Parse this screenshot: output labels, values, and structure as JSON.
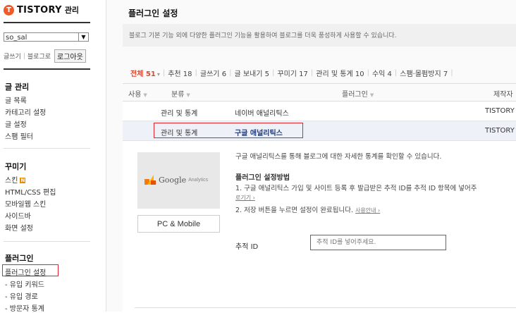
{
  "brand": {
    "mark": "T",
    "name": "TISTORY",
    "sub": "관리"
  },
  "sidebar": {
    "blog_select": "so_sal",
    "quick_links": {
      "write": "글쓰기",
      "blog": "블로그로",
      "logout": "로그아웃"
    },
    "sections": [
      {
        "title": "글 관리",
        "items": [
          "글 목록",
          "카테고리 설정",
          "글 설정",
          "스팸 필터"
        ]
      },
      {
        "title": "꾸미기",
        "items": [
          "스킨",
          "HTML/CSS 편집",
          "모바일웹 스킨",
          "사이드바",
          "화면 설정"
        ],
        "badge": "N"
      },
      {
        "title": "플러그인",
        "items": [
          "플러그인 설정",
          "- 유입 키워드",
          "- 유입 경로",
          "- 방문자 통계"
        ]
      }
    ]
  },
  "main": {
    "title": "플러그인 설정",
    "description": "블로그 기본 기능 외에 다양한 플러그인 기능을 활용하여 블로그를 더욱 풍성하게 사용할 수 있습니다.",
    "filters": [
      {
        "label": "전체",
        "count": "51"
      },
      {
        "label": "추천",
        "count": "18"
      },
      {
        "label": "글쓰기",
        "count": "6"
      },
      {
        "label": "글 보내기",
        "count": "5"
      },
      {
        "label": "꾸미기",
        "count": "17"
      },
      {
        "label": "관리 및 통계",
        "count": "10"
      },
      {
        "label": "수익",
        "count": "4"
      },
      {
        "label": "스팸·몰펌방지",
        "count": "7"
      }
    ],
    "table": {
      "headers": {
        "use": "사용",
        "category": "분류",
        "plugin": "플러그인",
        "author": "제작자"
      },
      "rows": [
        {
          "category": "관리 및 통계",
          "name": "네이버 애널리틱스",
          "author": "TISTORY"
        },
        {
          "category": "관리 및 통계",
          "name": "구글 애널리틱스",
          "author": "TISTORY"
        }
      ]
    },
    "detail": {
      "thumb_logo": "Google",
      "thumb_logo_sub": "Analytics",
      "platform": "PC & Mobile",
      "summary": "구글 애널리틱스를 통해 블로그에 대한 자세한 통계를 확인할 수 있습니다.",
      "howto_title": "플러그인 설정방법",
      "step1": "1. 구글 애널리틱스 가입 및 사이트 등록 후 발급받은 추적 ID를 추적 ID 항목에 넣어주",
      "step1_link": "로기기 ›",
      "step2": "2. 저장 버튼을 누르면 설정이 완료됩니다.",
      "step2_link": "사용안내 ›",
      "tracking_label": "추적 ID",
      "tracking_placeholder": "추적 ID를 넣어주세요."
    }
  },
  "colors": {
    "brand": "#f05a28",
    "highlight": "#e0262c",
    "active_filter": "#e0452b",
    "selected_row": "#eef2f8"
  }
}
